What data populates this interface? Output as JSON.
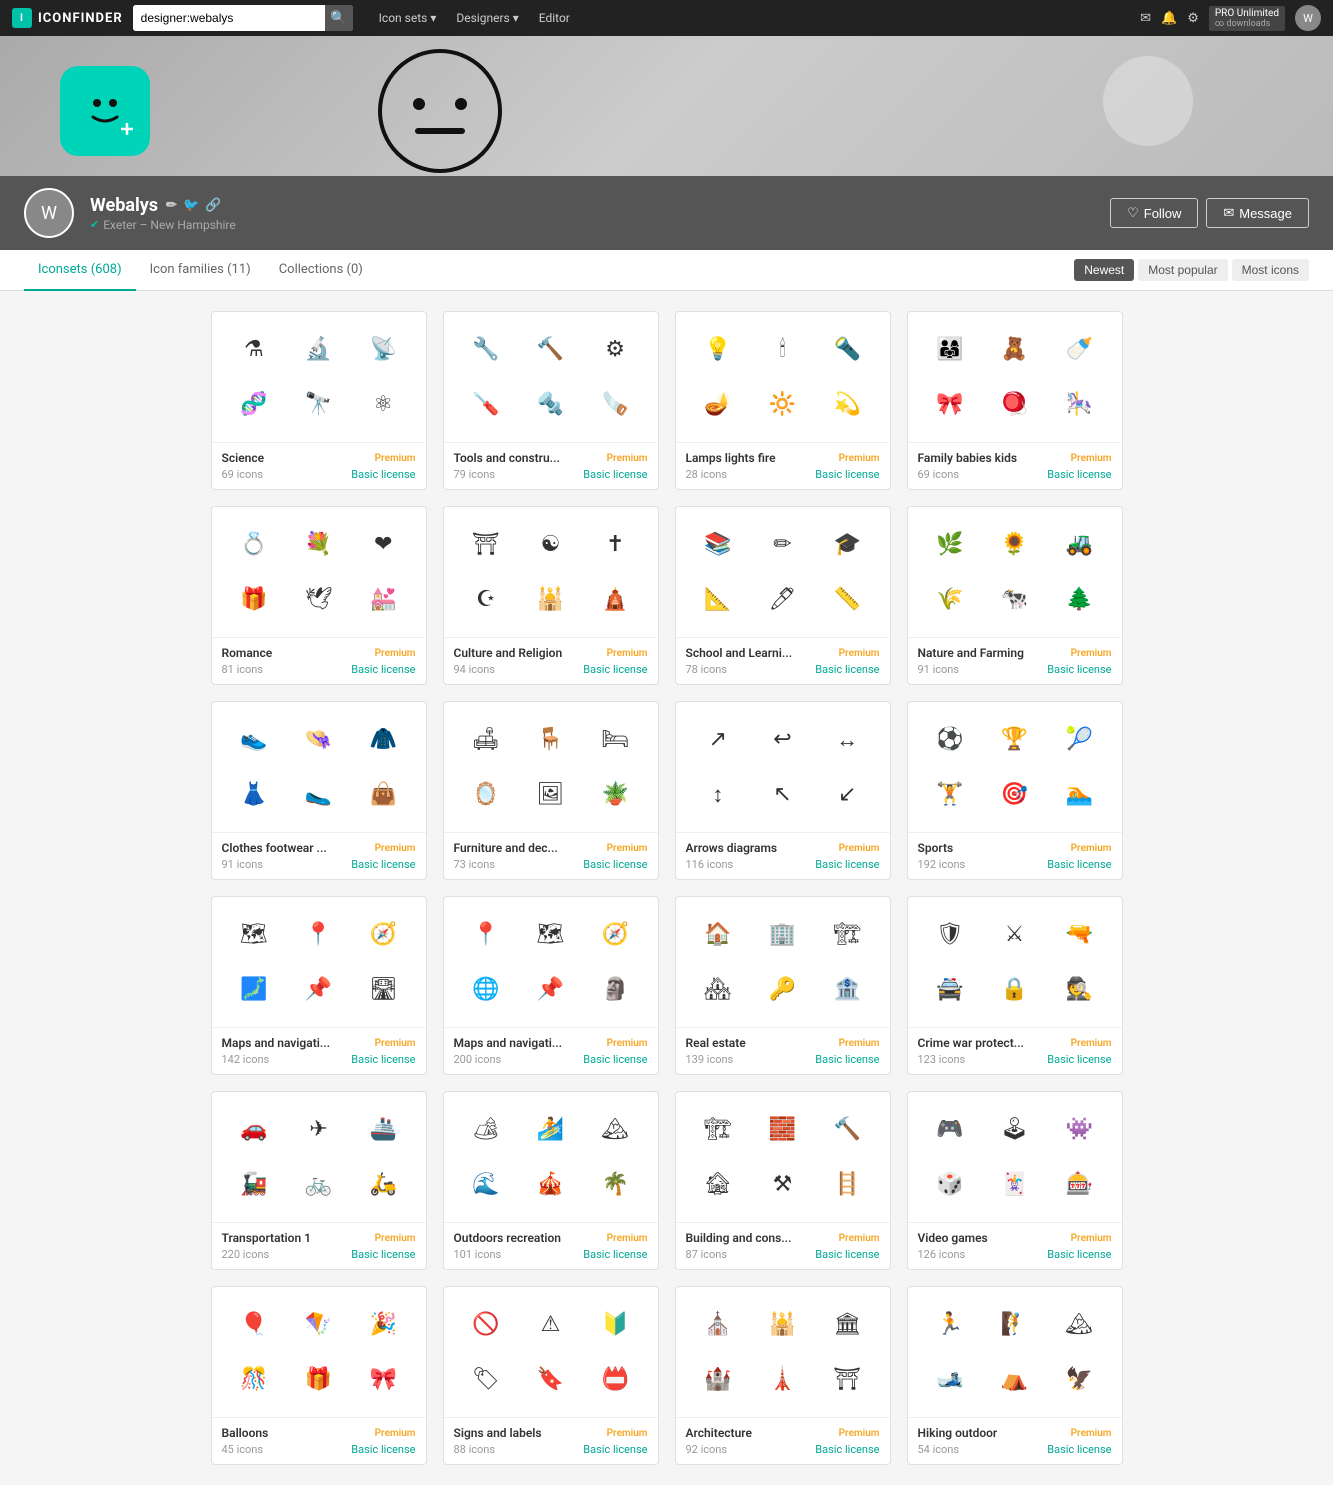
{
  "nav": {
    "brand": "ICONFINDER",
    "search_value": "designer:webalys",
    "search_placeholder": "designer:webalys",
    "links": [
      {
        "label": "Icon sets",
        "has_arrow": true
      },
      {
        "label": "Designers",
        "has_arrow": true
      },
      {
        "label": "Editor",
        "has_arrow": false
      }
    ],
    "pro_label": "PRO Unlimited",
    "pro_sub": "∞ downloads"
  },
  "profile": {
    "name": "Webalys",
    "location": "Exeter – New Hampshire",
    "verified": true,
    "follow_label": "Follow",
    "message_label": "Message"
  },
  "tabs": [
    {
      "label": "Iconsets (608)",
      "active": true
    },
    {
      "label": "Icon families (11)",
      "active": false
    },
    {
      "label": "Collections (0)",
      "active": false
    }
  ],
  "sort_options": [
    {
      "label": "Newest",
      "active": true
    },
    {
      "label": "Most popular",
      "active": false
    },
    {
      "label": "Most icons",
      "active": false
    }
  ],
  "icon_sets": [
    {
      "name": "Science",
      "count": "69 icons",
      "badge": "Premium",
      "license": "Basic license",
      "icons": [
        "⚗",
        "🔬",
        "📡",
        "🧬",
        "🔭",
        "⚛"
      ]
    },
    {
      "name": "Tools and constru...",
      "count": "79 icons",
      "badge": "Premium",
      "license": "Basic license",
      "icons": [
        "🔧",
        "🔨",
        "⚙",
        "🪛",
        "🔩",
        "🪚"
      ]
    },
    {
      "name": "Lamps lights fire",
      "count": "28 icons",
      "badge": "Premium",
      "license": "Basic license",
      "icons": [
        "💡",
        "🕯",
        "🔦",
        "🪔",
        "🔆",
        "💫"
      ]
    },
    {
      "name": "Family babies kids",
      "count": "69 icons",
      "badge": "Premium",
      "license": "Basic license",
      "icons": [
        "👨‍👩‍👧",
        "🧸",
        "🍼",
        "🎀",
        "🪀",
        "🎠"
      ]
    },
    {
      "name": "Romance",
      "count": "81 icons",
      "badge": "Premium",
      "license": "Basic license",
      "icons": [
        "💍",
        "💐",
        "❤",
        "🎁",
        "🕊",
        "💒"
      ]
    },
    {
      "name": "Culture and Religion",
      "count": "94 icons",
      "badge": "Premium",
      "license": "Basic license",
      "icons": [
        "⛩",
        "☯",
        "✝",
        "☪",
        "🕌",
        "🛕"
      ]
    },
    {
      "name": "School and Learni...",
      "count": "78 icons",
      "badge": "Premium",
      "license": "Basic license",
      "icons": [
        "📚",
        "✏",
        "🎓",
        "📐",
        "🖊",
        "📏"
      ]
    },
    {
      "name": "Nature and Farming",
      "count": "91 icons",
      "badge": "Premium",
      "license": "Basic license",
      "icons": [
        "🌿",
        "🌻",
        "🚜",
        "🌾",
        "🐄",
        "🌲"
      ]
    },
    {
      "name": "Clothes footwear ...",
      "count": "91 icons",
      "badge": "Premium",
      "license": "Basic license",
      "icons": [
        "👟",
        "👒",
        "🧥",
        "👗",
        "🥿",
        "👜"
      ]
    },
    {
      "name": "Furniture and dec...",
      "count": "73 icons",
      "badge": "Premium",
      "license": "Basic license",
      "icons": [
        "🛋",
        "🪑",
        "🛏",
        "🪞",
        "🖼",
        "🪴"
      ]
    },
    {
      "name": "Arrows diagrams",
      "count": "116 icons",
      "badge": "Premium",
      "license": "Basic license",
      "icons": [
        "↗",
        "↩",
        "↔",
        "↕",
        "↖",
        "↙"
      ]
    },
    {
      "name": "Sports",
      "count": "192 icons",
      "badge": "Premium",
      "license": "Basic license",
      "icons": [
        "⚽",
        "🏆",
        "🎾",
        "🏋",
        "🎯",
        "🏊"
      ]
    },
    {
      "name": "Maps and navigati...",
      "count": "142 icons",
      "badge": "Premium",
      "license": "Basic license",
      "icons": [
        "🗺",
        "📍",
        "🧭",
        "🗾",
        "📌",
        "🛣"
      ]
    },
    {
      "name": "Maps and navigati...",
      "count": "200 icons",
      "badge": "Premium",
      "license": "Basic license",
      "icons": [
        "📍",
        "🗺",
        "🧭",
        "🌐",
        "📌",
        "🗿"
      ]
    },
    {
      "name": "Real estate",
      "count": "139 icons",
      "badge": "Premium",
      "license": "Basic license",
      "icons": [
        "🏠",
        "🏢",
        "🏗",
        "🏘",
        "🔑",
        "🏦"
      ]
    },
    {
      "name": "Crime war protect...",
      "count": "123 icons",
      "badge": "Premium",
      "license": "Basic license",
      "icons": [
        "🛡",
        "⚔",
        "🔫",
        "🚔",
        "🔒",
        "🕵"
      ]
    },
    {
      "name": "Transportation 1",
      "count": "220 icons",
      "badge": "Premium",
      "license": "Basic license",
      "icons": [
        "🚗",
        "✈",
        "🚢",
        "🚂",
        "🚲",
        "🛵"
      ]
    },
    {
      "name": "Outdoors recreation",
      "count": "101 icons",
      "badge": "Premium",
      "license": "Basic license",
      "icons": [
        "🏕",
        "🏄",
        "🏔",
        "🌊",
        "🎪",
        "🌴"
      ]
    },
    {
      "name": "Building and cons...",
      "count": "87 icons",
      "badge": "Premium",
      "license": "Basic license",
      "icons": [
        "🏗",
        "🧱",
        "🔨",
        "🏚",
        "⚒",
        "🪜"
      ]
    },
    {
      "name": "Video games",
      "count": "126 icons",
      "badge": "Premium",
      "license": "Basic license",
      "icons": [
        "🎮",
        "🕹",
        "👾",
        "🎲",
        "🃏",
        "🎰"
      ]
    },
    {
      "name": "Balloons",
      "count": "45 icons",
      "badge": "Premium",
      "license": "Basic license",
      "icons": [
        "🎈",
        "🪁",
        "🎉",
        "🎊",
        "🎁",
        "🎀"
      ]
    },
    {
      "name": "Signs and labels",
      "count": "88 icons",
      "badge": "Premium",
      "license": "Basic license",
      "icons": [
        "🚫",
        "⚠",
        "🔰",
        "🏷",
        "🔖",
        "📛"
      ]
    },
    {
      "name": "Architecture",
      "count": "92 icons",
      "badge": "Premium",
      "license": "Basic license",
      "icons": [
        "⛪",
        "🕌",
        "🏛",
        "🏰",
        "🗼",
        "⛩"
      ]
    },
    {
      "name": "Hiking outdoor",
      "count": "54 icons",
      "badge": "Premium",
      "license": "Basic license",
      "icons": [
        "🏃",
        "🧗",
        "🏔",
        "🎿",
        "⛺",
        "🦅"
      ]
    }
  ]
}
